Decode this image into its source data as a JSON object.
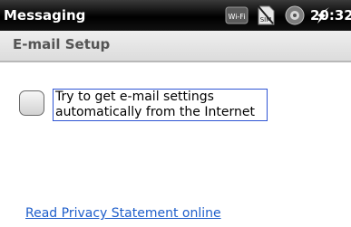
{
  "status_bar": {
    "app_name": "Messaging",
    "clock": "20:32",
    "icons": [
      "wifi-icon",
      "sim-icon",
      "sync-icon",
      "charging-icon"
    ],
    "wifi_text": "Wi-Fi",
    "sim_text": "SIM"
  },
  "header": {
    "title": "E-mail Setup"
  },
  "auto_settings": {
    "label": "Try to get e-mail settings automatically from the Internet",
    "checked": false
  },
  "privacy_link": {
    "label": "Read Privacy Statement online"
  },
  "colors": {
    "accent": "#2f55d4",
    "link": "#1f5fcb",
    "status_bg": "#000000"
  }
}
